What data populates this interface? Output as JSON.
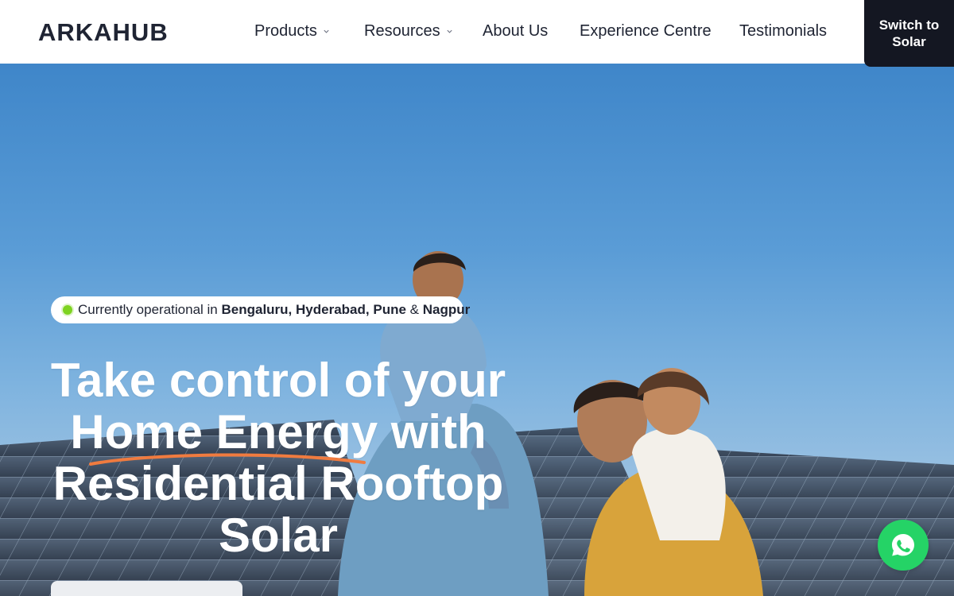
{
  "brand": {
    "name": "ARKAHUB"
  },
  "nav": {
    "items": [
      {
        "label": "Products",
        "has_dropdown": true
      },
      {
        "label": "Resources",
        "has_dropdown": true
      },
      {
        "label": "About Us",
        "has_dropdown": false
      },
      {
        "label": "Experience Centre",
        "has_dropdown": false
      },
      {
        "label": "Testimonials",
        "has_dropdown": false
      }
    ],
    "cta_label": "Switch to Solar"
  },
  "hero": {
    "badge": {
      "prefix": "Currently operational in",
      "city1": "Bengaluru,",
      "city2": "Hyderabad,",
      "city3": "Pune",
      "joiner": "&",
      "city4": "Nagpur"
    },
    "headline": {
      "line1": "Take control of your",
      "line2": "Home Energy with",
      "line3": "Residential Rooftop",
      "line4": "Solar"
    }
  },
  "colors": {
    "nav_text": "#1f2433",
    "cta_bg": "#141722",
    "status_dot": "#7ed321",
    "underline_accent": "#f07b3f",
    "whatsapp": "#25d366"
  },
  "icons": {
    "dropdown": "chevron-down-icon",
    "chat": "whatsapp-icon",
    "status": "status-dot-icon"
  }
}
